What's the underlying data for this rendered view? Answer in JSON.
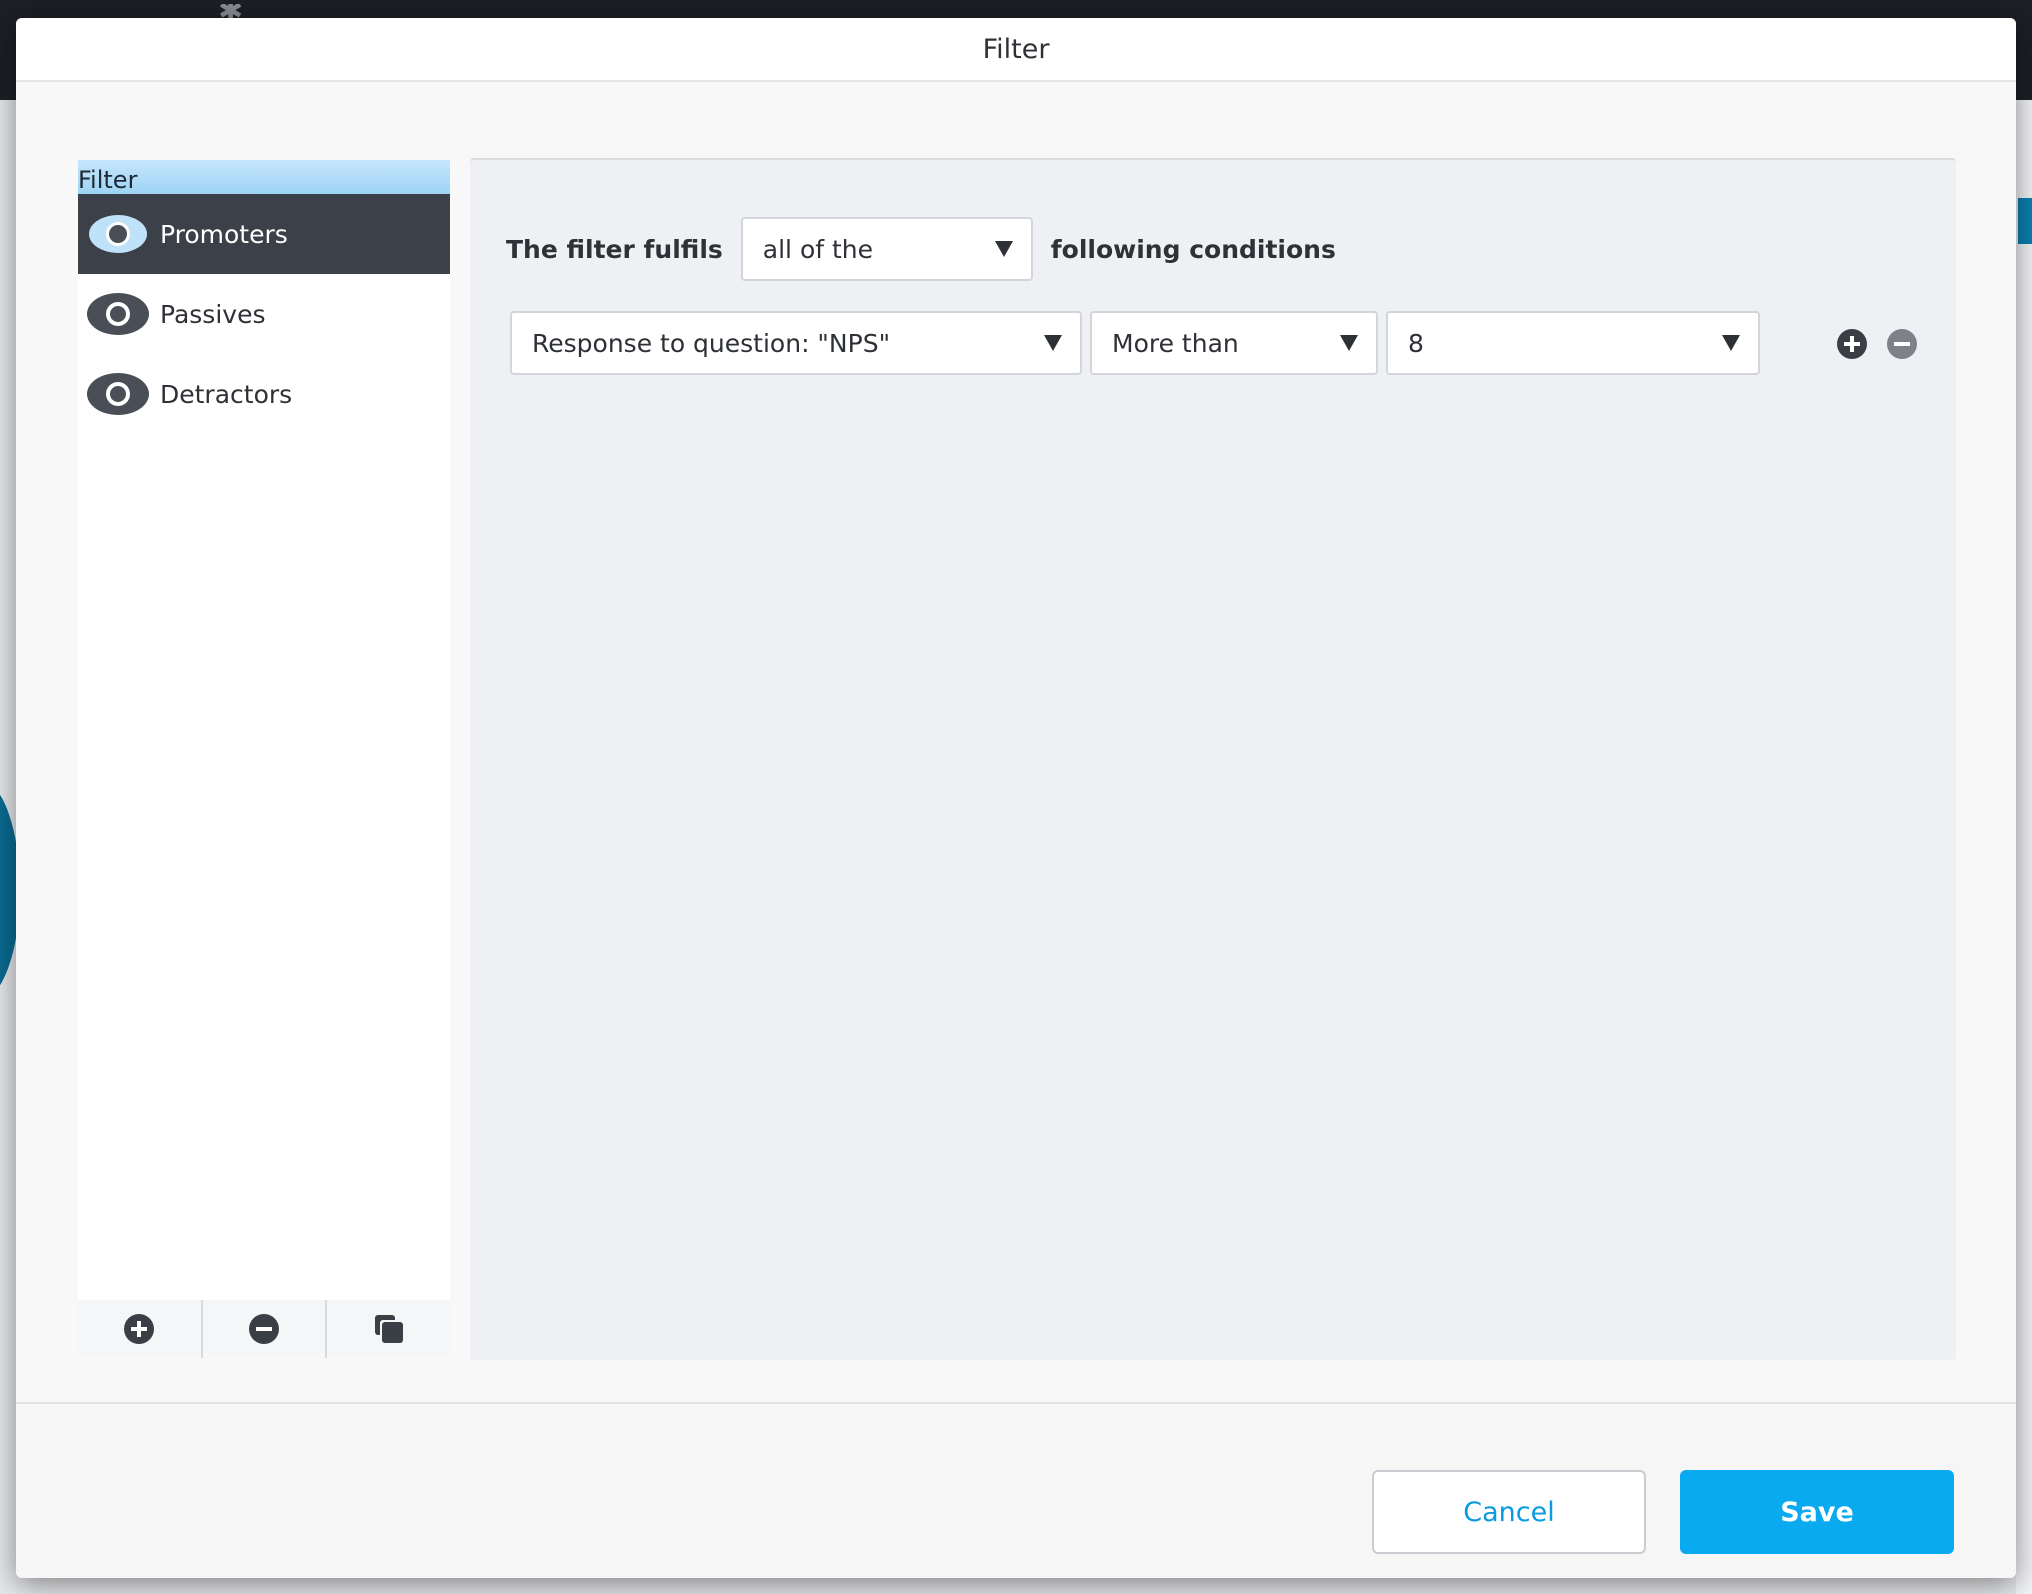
{
  "modal": {
    "title": "Filter"
  },
  "filter_list": {
    "header": "Filter",
    "items": [
      {
        "label": "Promoters",
        "selected": true
      },
      {
        "label": "Passives",
        "selected": false
      },
      {
        "label": "Detractors",
        "selected": false
      }
    ],
    "toolbar": {
      "add_icon": "plus-circle-icon",
      "remove_icon": "minus-circle-icon",
      "duplicate_icon": "duplicate-icon"
    }
  },
  "conditions": {
    "prefix": "The filter fulfils",
    "quantifier": "all of the",
    "suffix": "following conditions",
    "rows": [
      {
        "field": "Response to question: \"NPS\"",
        "operator": "More than",
        "value": "8"
      }
    ]
  },
  "footer": {
    "cancel_label": "Cancel",
    "save_label": "Save"
  },
  "colors": {
    "accent": "#0aaaf0",
    "selected_row": "#3c4149",
    "list_header": "#9dd3f5"
  }
}
